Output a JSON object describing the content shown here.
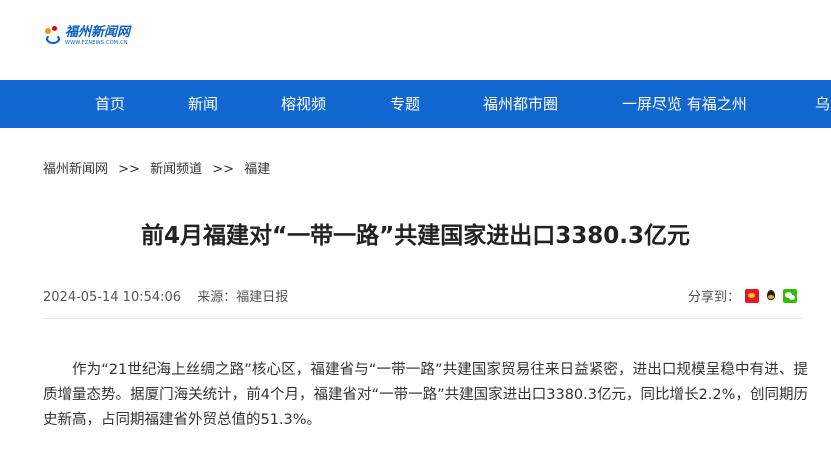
{
  "site": {
    "logo_cn": "福州新闻网",
    "logo_en": "WWW.FZNEWS.COM.CN"
  },
  "nav": {
    "items": [
      {
        "label": "首页"
      },
      {
        "label": "新闻"
      },
      {
        "label": "榕视频"
      },
      {
        "label": "专题"
      },
      {
        "label": "福州都市圈"
      },
      {
        "label": "一屏尽览 有福之州"
      },
      {
        "label": "乌"
      }
    ]
  },
  "breadcrumb": {
    "items": [
      "福州新闻网",
      "新闻频道",
      "福建"
    ],
    "separator": ">>"
  },
  "article": {
    "title": "前4月福建对“一带一路”共建国家进出口3380.3亿元",
    "datetime": "2024-05-14 10:54:06",
    "source": "来源：福建日报",
    "share_label": "分享到：",
    "body": "作为“21世纪海上丝绸之路”核心区，福建省与“一带一路”共建国家贸易往来日益紧密，进出口规模呈稳中有进、提质增量态势。据厦门海关统计，前4个月，福建省对“一带一路”共建国家进出口3380.3亿元，同比增长2.2%，创同期历史新高，占同期福建省外贸总值的51.3%。"
  },
  "share_icons": [
    "weibo-icon",
    "qq-icon",
    "wechat-icon"
  ],
  "colors": {
    "nav_bg": "#1266d0",
    "brand_blue": "#0b5fc7"
  }
}
